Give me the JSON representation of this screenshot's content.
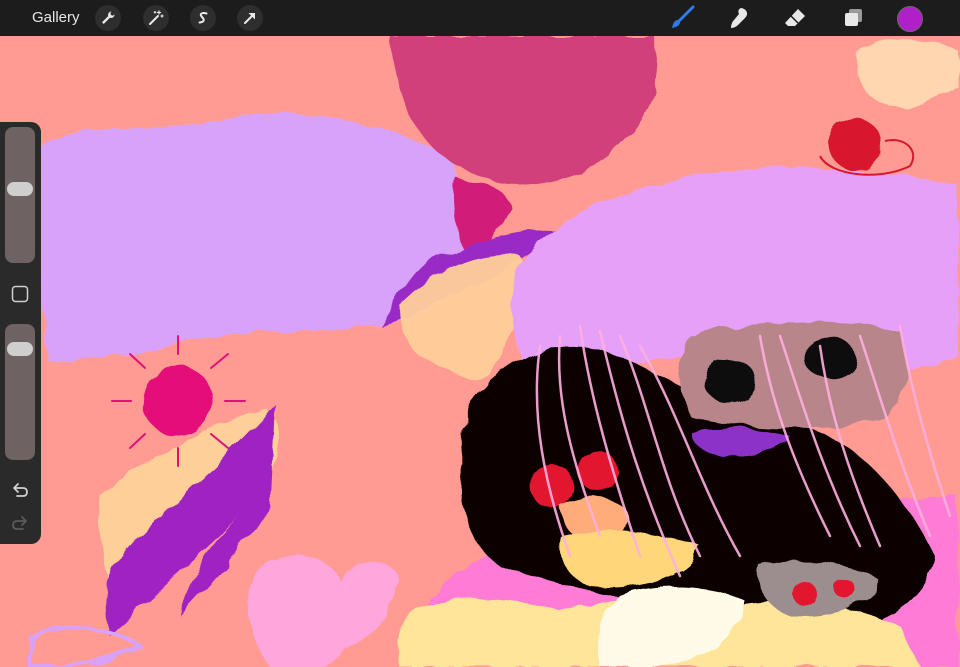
{
  "header": {
    "gallery_label": "Gallery",
    "left_tools": [
      "wrench-icon",
      "magic-wand-icon",
      "selection-s-icon",
      "transform-arrow-icon"
    ],
    "right_tools": [
      "brush-icon",
      "smudge-icon",
      "eraser-icon",
      "layers-icon"
    ],
    "active_tool": "brush-icon",
    "current_color": "#b020c8"
  },
  "sidebar": {
    "brush_size_level": 0.55,
    "opacity_level": 0.85,
    "modify_button_icon": "square-icon",
    "undo_icon": "undo-icon",
    "redo_icon": "redo-icon",
    "redo_enabled": false
  },
  "colors": {
    "accent_blue": "#2f7ae8",
    "canvas_background": "#ff9b92"
  }
}
